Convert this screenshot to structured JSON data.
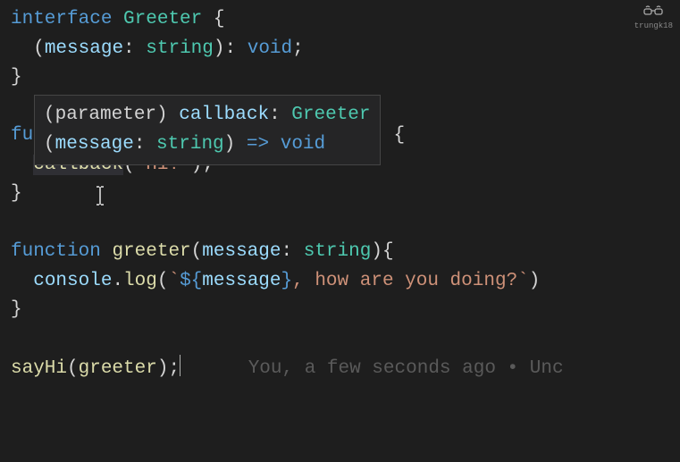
{
  "code": {
    "line1": {
      "interface": "interface",
      "greeter": "Greeter",
      "brace": "{"
    },
    "line2": {
      "message": "message",
      "colon1": ":",
      "string": "string",
      "colon2": ":",
      "void": "void",
      "semi": ";"
    },
    "line3": {
      "brace": "}"
    },
    "line5": {
      "fu": "fu",
      "braceEnd": " {"
    },
    "line6": {
      "callback": "callback",
      "paren1": "(",
      "hi": "\"Hi!\"",
      "paren2": ")",
      "semi": ";"
    },
    "line7": {
      "brace": "}"
    },
    "line9": {
      "function": "function",
      "greeter": "greeter",
      "paren1": "(",
      "message": "message",
      "colon": ":",
      "string": "string",
      "paren2": ")",
      "brace": "{"
    },
    "line10": {
      "console": "console",
      "dot": ".",
      "log": "log",
      "paren1": "(",
      "tick1": "`",
      "templ1": "${",
      "message": "message",
      "templ2": "}",
      "rest": ", how are you doing?",
      "tick2": "`",
      "paren2": ")"
    },
    "line11": {
      "brace": "}"
    },
    "line13": {
      "sayHi": "sayHi",
      "paren1": "(",
      "greeter": "greeter",
      "paren2": ")",
      "semi": ";"
    }
  },
  "tooltip": {
    "line1": {
      "parameter": "(parameter)",
      "callback": "callback",
      "colon": ":",
      "greeter": "Greeter"
    },
    "line2": {
      "paren1": "(",
      "message": "message",
      "colon": ":",
      "string": "string",
      "paren2": ")",
      "arrow": "=>",
      "void": "void"
    }
  },
  "blame": {
    "text": "You, a few seconds ago • Unc"
  },
  "logo": {
    "label": "trungk18"
  }
}
